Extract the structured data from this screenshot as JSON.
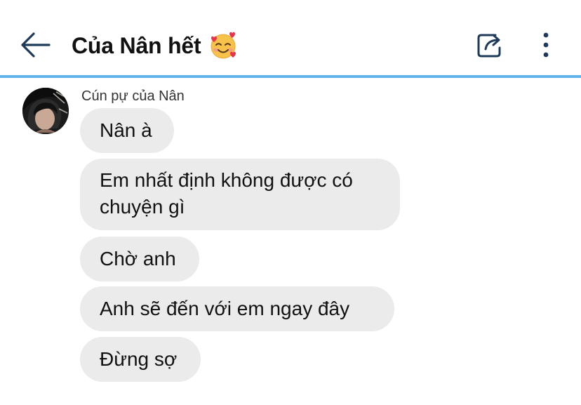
{
  "header": {
    "title": "Của Nân hết",
    "title_emoji": "smiling-face-with-hearts-icon",
    "back_icon": "arrow-left-icon",
    "share_icon": "share-icon",
    "more_icon": "more-vertical-icon",
    "divider_color": "#5fb3e8"
  },
  "conversation": {
    "sender": {
      "name": "Cún pự của Nân",
      "avatar_icon": "avatar"
    },
    "bubble_color": "#ebebeb",
    "messages": [
      {
        "text": "Nân à"
      },
      {
        "text": "Em nhất định không được có chuyện gì"
      },
      {
        "text": "Chờ anh"
      },
      {
        "text": "Anh sẽ đến với em ngay đây"
      },
      {
        "text": "Đừng sợ"
      }
    ]
  }
}
